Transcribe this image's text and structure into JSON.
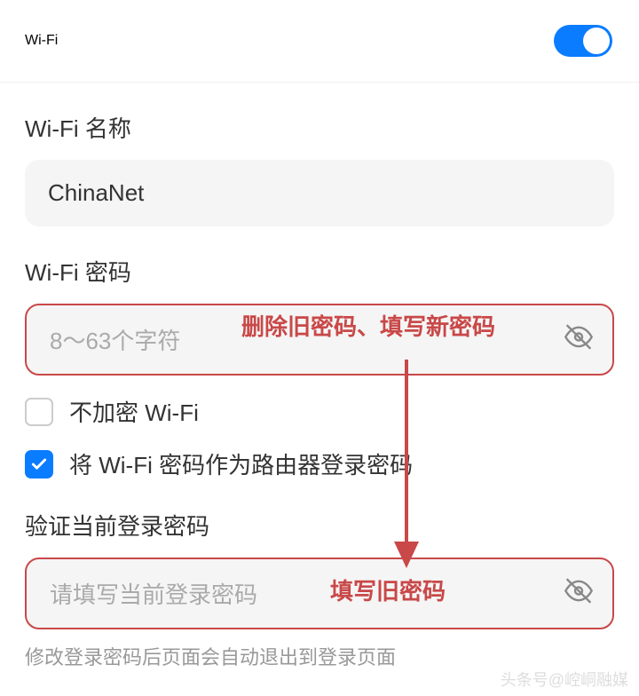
{
  "header": {
    "title": "Wi-Fi",
    "toggle_on": true
  },
  "wifi_name": {
    "label": "Wi-Fi 名称",
    "value": "ChinaNet"
  },
  "wifi_password": {
    "label": "Wi-Fi 密码",
    "placeholder": "8～63个字符",
    "annotation": "删除旧密码、填写新密码"
  },
  "no_encrypt": {
    "label": "不加密 Wi-Fi",
    "checked": false
  },
  "use_as_router_pwd": {
    "label": "将 Wi-Fi 密码作为路由器登录密码",
    "checked": true
  },
  "verify_password": {
    "label": "验证当前登录密码",
    "placeholder": "请填写当前登录密码",
    "annotation": "填写旧密码"
  },
  "footer": {
    "note": "修改登录密码后页面会自动退出到登录页面"
  },
  "watermark": "头条号@崆峒融媒"
}
